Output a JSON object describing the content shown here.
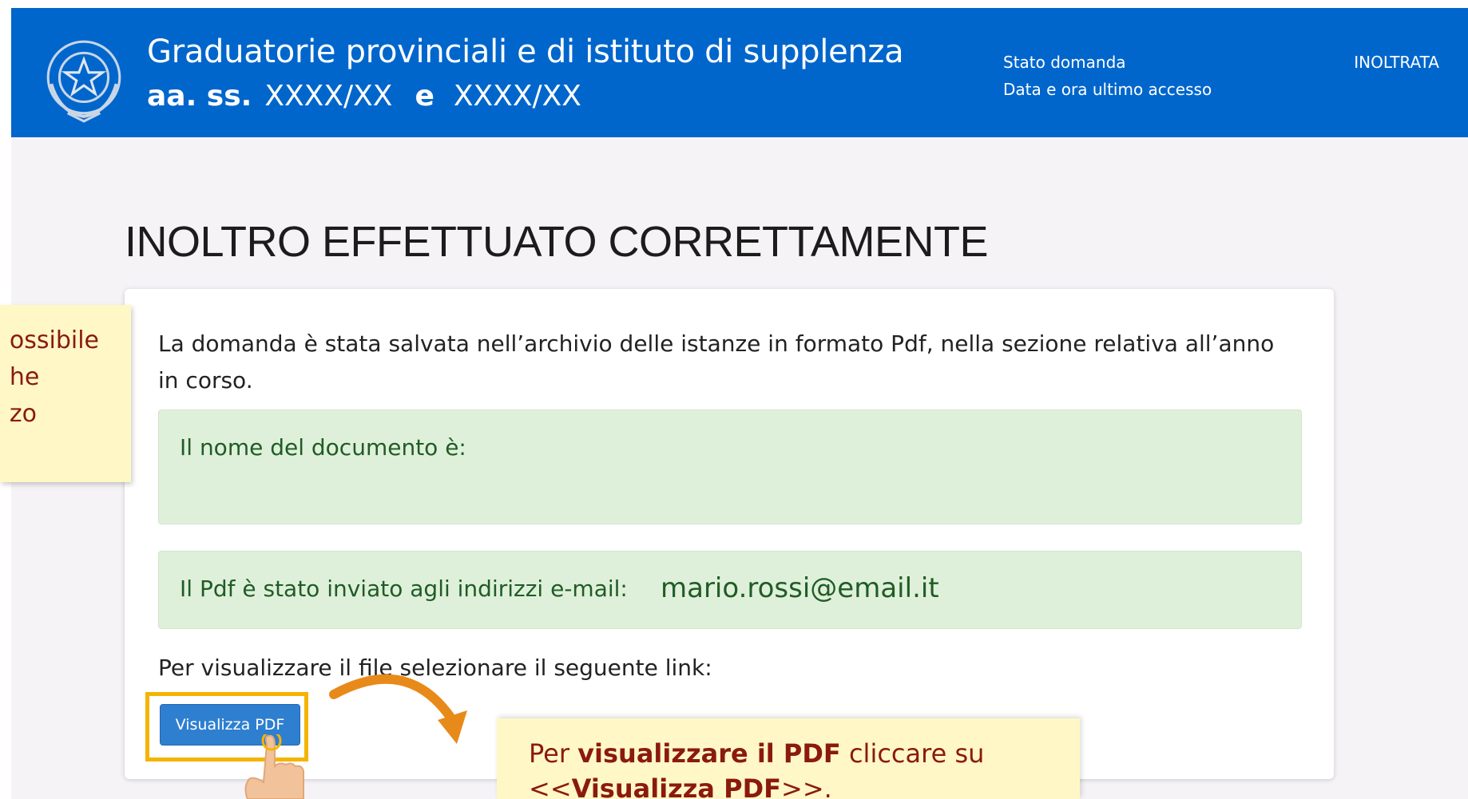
{
  "header": {
    "title": "Graduatorie provinciali e di istituto di supplenza",
    "subtitle_prefix": "aa. ss.",
    "year_from": "XXXX/XX",
    "conjunction": "e",
    "year_to": "XXXX/XX",
    "state_label": "Stato domanda",
    "access_label": "Data e ora ultimo accesso",
    "state_value": "INOLTRATA"
  },
  "main": {
    "heading": "INOLTRO EFFETTUATO CORRETTAMENTE",
    "saved_message": "La domanda è stata salvata nell’archivio delle istanze in formato Pdf, nella sezione relativa all’anno in corso.",
    "document_name_label": "Il nome del documento è:",
    "email_label": "Il Pdf è stato inviato agli indirizzi e-mail:",
    "email_value": "mario.rossi@email.it",
    "link_text": "Per visualizzare il file selezionare il seguente link:",
    "pdf_button_label": "Visualizza PDF"
  },
  "notes": {
    "left_lines": [
      "ossibile",
      "he",
      "zo"
    ],
    "bottom_prefix": "Per ",
    "bottom_bold1": "visualizzare il PDF",
    "bottom_mid": " cliccare su",
    "bottom_open": "<<",
    "bottom_bold2": "Visualizza PDF",
    "bottom_close": ">>."
  },
  "colors": {
    "header_bg": "#0066cc",
    "page_bg": "#f5f3f6",
    "alert_bg": "#dff0da",
    "alert_text": "#1f5c26",
    "button_bg": "#2e7fd0",
    "note_bg": "#fff8c6",
    "note_text": "#8b1a0e",
    "highlight": "#f5b400",
    "arrow": "#e88a1a"
  }
}
